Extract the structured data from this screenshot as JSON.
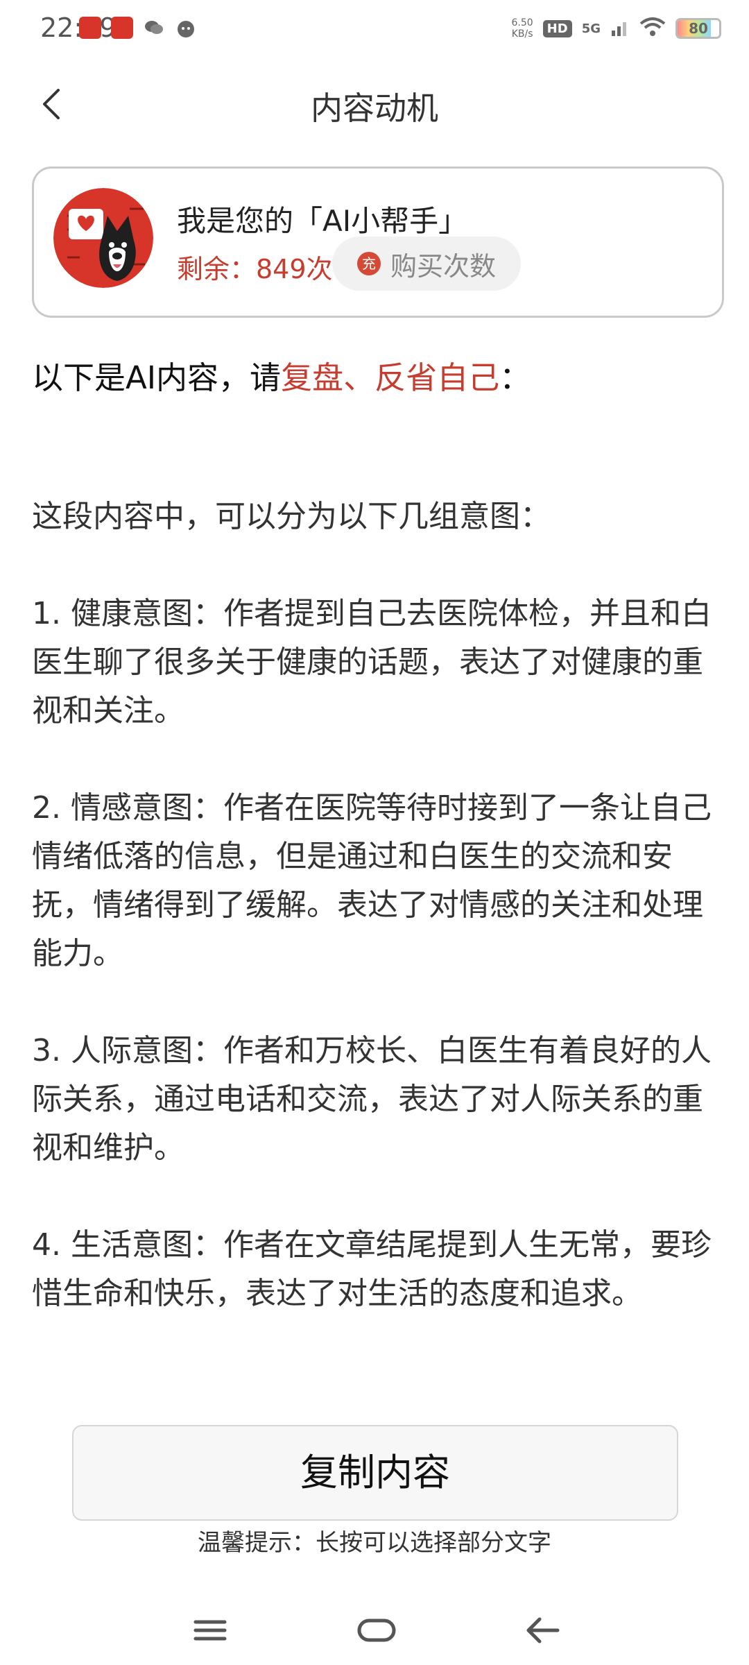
{
  "status_bar": {
    "time": "22:49",
    "net_speed_value": "6.50",
    "net_speed_unit": "KB/s",
    "hd": "HD",
    "signal": "5G",
    "battery": "80"
  },
  "header": {
    "title": "内容动机"
  },
  "assistant": {
    "name": "我是您的「AI小帮手」",
    "remaining": "剩余：849次",
    "buy_icon": "充",
    "buy_label": "购买次数"
  },
  "intro": {
    "prefix": "以下是AI内容，请",
    "highlight": "复盘、反省自己",
    "suffix": "："
  },
  "content": {
    "paragraphs": [
      "这段内容中，可以分为以下几组意图：",
      "1. 健康意图：作者提到自己去医院体检，并且和白医生聊了很多关于健康的话题，表达了对健康的重视和关注。",
      "2. 情感意图：作者在医院等待时接到了一条让自己情绪低落的信息，但是通过和白医生的交流和安抚，情绪得到了缓解。表达了对情感的关注和处理能力。",
      "3. 人际意图：作者和万校长、白医生有着良好的人际关系，通过电话和交流，表达了对人际关系的重视和维护。",
      "4. 生活意图：作者在文章结尾提到人生无常，要珍惜生命和快乐，表达了对生活的态度和追求。"
    ]
  },
  "actions": {
    "copy_label": "复制内容",
    "hint": "温馨提示：长按可以选择部分文字"
  },
  "icons": {
    "back": "chevron-left-icon",
    "menu": "menu-icon",
    "home": "home-icon",
    "nav_back": "back-arrow-icon"
  },
  "colors": {
    "accent": "#c63d2f"
  }
}
